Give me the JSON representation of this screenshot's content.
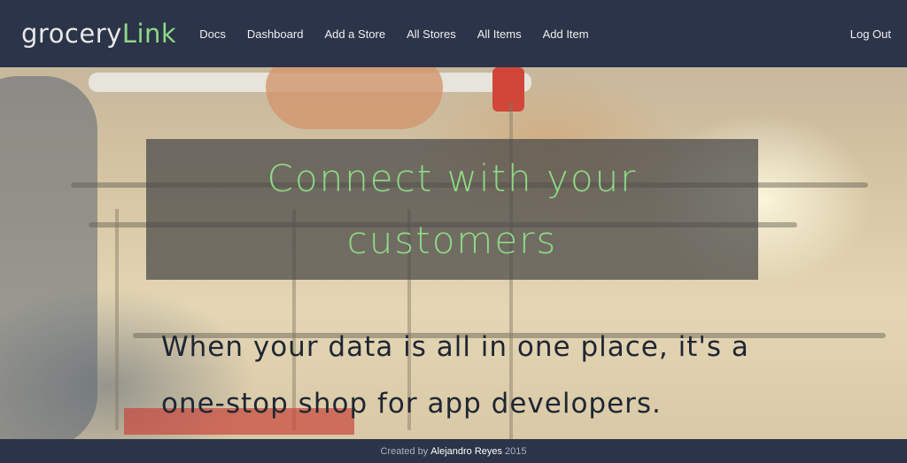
{
  "brand": {
    "part1": "grocery",
    "part2": "Link"
  },
  "nav": {
    "links": [
      "Docs",
      "Dashboard",
      "Add a Store",
      "All Stores",
      "All Items",
      "Add Item"
    ],
    "logout": "Log Out"
  },
  "hero": {
    "headline": "Connect with your customers",
    "subtext": "When your data is all in one place, it's a one-stop shop for app developers."
  },
  "footer": {
    "prefix": "Created by",
    "author": "Alejandro Reyes",
    "year": "2015"
  },
  "colors": {
    "navbar_bg": "#2b3448",
    "brand_accent": "#8fd986",
    "headline_box": "#464646"
  }
}
